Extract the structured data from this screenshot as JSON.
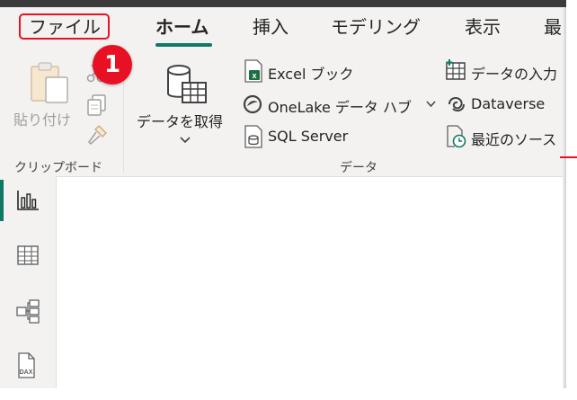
{
  "tabs": [
    {
      "label": "ファイル"
    },
    {
      "label": "ホーム"
    },
    {
      "label": "挿入"
    },
    {
      "label": "モデリング"
    },
    {
      "label": "表示"
    },
    {
      "label": "最"
    }
  ],
  "callout": {
    "number": "1"
  },
  "clipboard": {
    "paste_label": "貼り付け",
    "group_label": "クリップボード"
  },
  "data_group": {
    "get_data_label": "データを取得",
    "items": [
      {
        "label": "Excel ブック",
        "icon": "excel-icon"
      },
      {
        "label": "OneLake データ ハブ",
        "icon": "onelake-icon"
      },
      {
        "label": "SQL Server",
        "icon": "sql-server-icon"
      },
      {
        "label": "データの入力",
        "icon": "enter-data-icon"
      },
      {
        "label": "Dataverse",
        "icon": "dataverse-icon"
      },
      {
        "label": "最近のソース",
        "icon": "recent-sources-icon"
      }
    ],
    "group_label": "データ"
  },
  "colors": {
    "accent": "#117865",
    "highlight": "#e81123",
    "excel": "#1d6f42"
  }
}
